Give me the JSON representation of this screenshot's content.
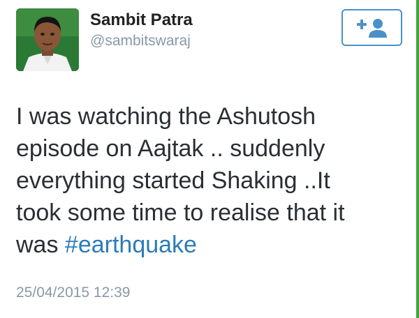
{
  "user": {
    "display_name": "Sambit Patra",
    "handle": "@sambitswaraj"
  },
  "follow_button": {
    "icon": "add-user-icon",
    "color": "#4a90c9"
  },
  "tweet": {
    "lines": [
      "I was watching the Ashutosh",
      "episode on Aajtak .. suddenly",
      "everything started Shaking ..It",
      "took some time to realise that it"
    ],
    "last_line_prefix": "was ",
    "hashtag": "#earthquake",
    "timestamp": "25/04/2015 12:39"
  },
  "colors": {
    "hashtag": "#2b7bb9",
    "meta_text": "#8899a6",
    "border_accent": "#3fa53f"
  }
}
